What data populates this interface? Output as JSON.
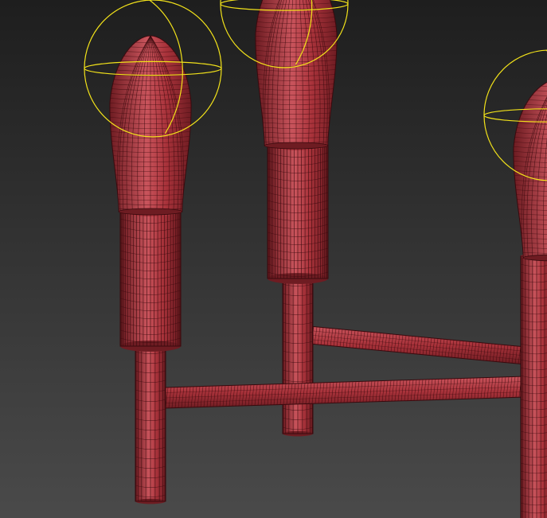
{
  "viewport": {
    "kind": "3d-perspective-viewport",
    "shading": "wireframe-over-shaded",
    "colors": {
      "background_top": "#1e1e1e",
      "background_bottom": "#4a4a4a",
      "mesh_fill": "#a8323a",
      "mesh_fill_dark": "#6e1c22",
      "mesh_highlight": "#c9545c",
      "wire": "#3a0a0e",
      "light_gizmo": "#f2e21a"
    }
  },
  "scene": {
    "objects": [
      {
        "id": "candle-left",
        "type": "candle-holder",
        "parts": [
          "flame-bulb",
          "sleeve",
          "stem"
        ]
      },
      {
        "id": "candle-center",
        "type": "candle-holder",
        "parts": [
          "flame-bulb",
          "sleeve",
          "stem"
        ]
      },
      {
        "id": "candle-right",
        "type": "candle-holder",
        "parts": [
          "flame-bulb",
          "sleeve"
        ],
        "partially_visible": true
      },
      {
        "id": "arm-front",
        "type": "connecting-arm"
      },
      {
        "id": "arm-back",
        "type": "connecting-arm"
      }
    ],
    "lights": [
      {
        "id": "light-left",
        "type": "omni-light",
        "icon": "light-gizmo-icon"
      },
      {
        "id": "light-center",
        "type": "omni-light",
        "icon": "light-gizmo-icon"
      },
      {
        "id": "light-right",
        "type": "omni-light",
        "icon": "light-gizmo-icon",
        "partially_visible": true
      }
    ]
  }
}
